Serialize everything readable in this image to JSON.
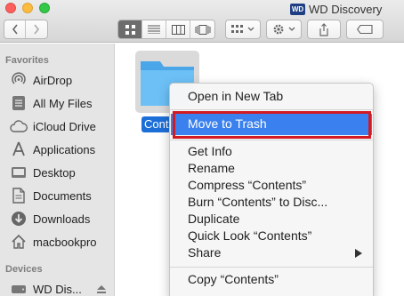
{
  "window": {
    "title": "WD Discovery",
    "logo_text": "WD"
  },
  "sidebar": {
    "favorites_heading": "Favorites",
    "items": [
      {
        "label": "AirDrop",
        "icon": "airdrop-icon"
      },
      {
        "label": "All My Files",
        "icon": "all-files-icon"
      },
      {
        "label": "iCloud Drive",
        "icon": "cloud-icon"
      },
      {
        "label": "Applications",
        "icon": "applications-icon"
      },
      {
        "label": "Desktop",
        "icon": "desktop-icon"
      },
      {
        "label": "Documents",
        "icon": "documents-icon"
      },
      {
        "label": "Downloads",
        "icon": "downloads-icon"
      },
      {
        "label": "macbookpro",
        "icon": "home-icon"
      }
    ],
    "devices_heading": "Devices",
    "devices": [
      {
        "label": "WD Dis...",
        "icon": "drive-icon"
      }
    ]
  },
  "folder": {
    "label": "Cont",
    "selected": true
  },
  "context_menu": {
    "items": [
      {
        "label": "Open in New Tab"
      },
      {
        "label": "Move to Trash",
        "highlighted": true
      },
      {
        "label": "Get Info"
      },
      {
        "label": "Rename"
      },
      {
        "label": "Compress “Contents”"
      },
      {
        "label": "Burn “Contents” to Disc..."
      },
      {
        "label": "Duplicate"
      },
      {
        "label": "Quick Look “Contents”"
      },
      {
        "label": "Share",
        "submenu": true
      },
      {
        "label": "Copy “Contents”"
      }
    ]
  },
  "colors": {
    "highlight": "#3a80ee",
    "annotation_box": "#d11a22",
    "folder": "#5fb7f1"
  }
}
